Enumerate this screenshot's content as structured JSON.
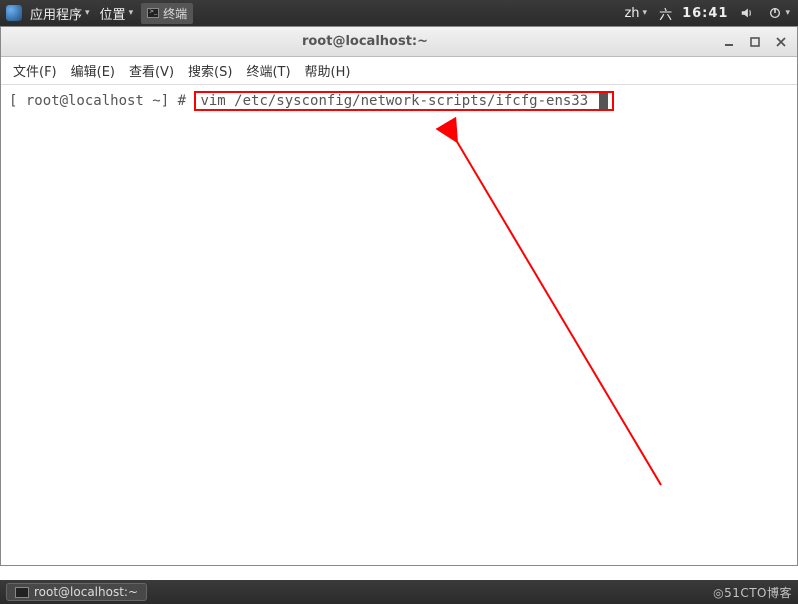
{
  "top_panel": {
    "apps_label": "应用程序",
    "places_label": "位置",
    "task_label": "终端",
    "lang": "zh",
    "day": "六",
    "time": "16:41"
  },
  "window": {
    "title": "root@localhost:~",
    "menu": {
      "file": "文件(F)",
      "edit": "编辑(E)",
      "view": "查看(V)",
      "search": "搜索(S)",
      "terminal": "终端(T)",
      "help": "帮助(H)"
    }
  },
  "terminal": {
    "prompt": "[ root@localhost ~] # ",
    "command": "vim /etc/sysconfig/network-scripts/ifcfg-ens33"
  },
  "bottom_panel": {
    "task_label": "root@localhost:~",
    "watermark": "◎51CTO博客"
  }
}
